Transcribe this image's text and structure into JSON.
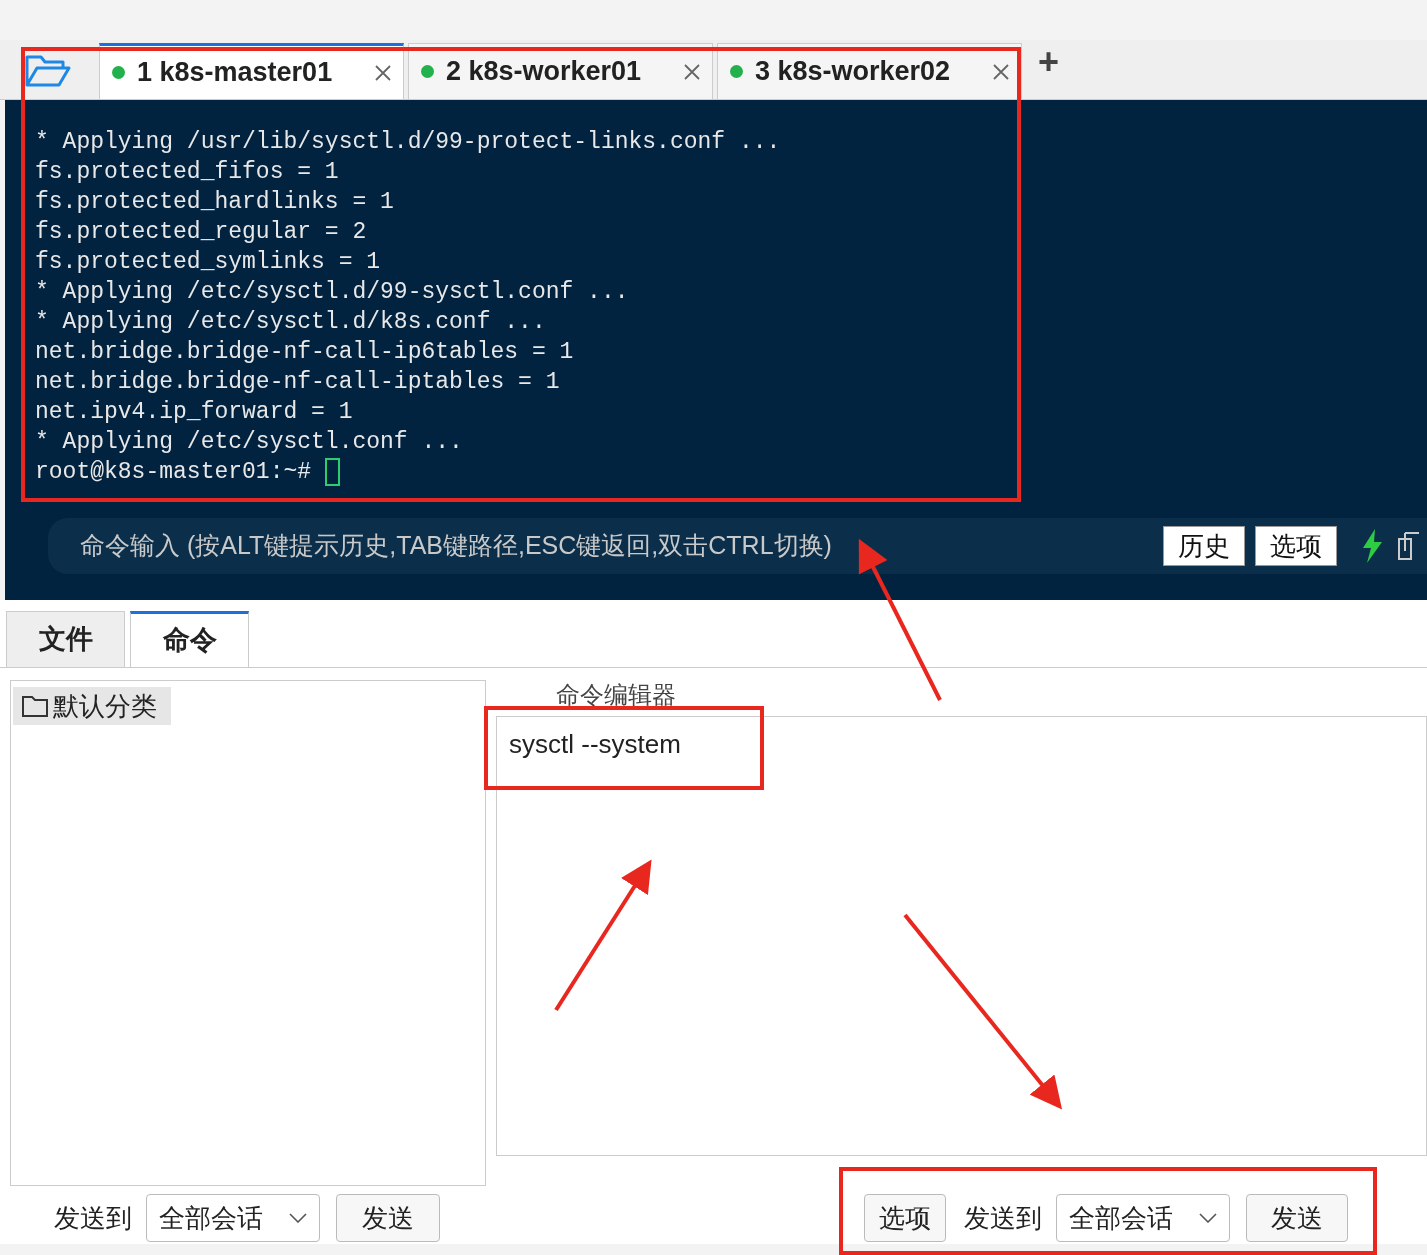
{
  "session_tabs": [
    {
      "label": "1 k8s-master01",
      "color": "#22b14c",
      "selected": true
    },
    {
      "label": "2 k8s-worker01",
      "color": "#22b14c",
      "selected": false
    },
    {
      "label": "3 k8s-worker02",
      "color": "#22b14c",
      "selected": false
    }
  ],
  "new_tab": "+",
  "terminal": {
    "lines": [
      "* Applying /usr/lib/sysctl.d/99-protect-links.conf ...",
      "fs.protected_fifos = 1",
      "fs.protected_hardlinks = 1",
      "fs.protected_regular = 2",
      "fs.protected_symlinks = 1",
      "* Applying /etc/sysctl.d/99-sysctl.conf ...",
      "* Applying /etc/sysctl.d/k8s.conf ...",
      "net.bridge.bridge-nf-call-ip6tables = 1",
      "net.bridge.bridge-nf-call-iptables = 1",
      "net.ipv4.ip_forward = 1",
      "* Applying /etc/sysctl.conf ..."
    ],
    "prompt": "root@k8s-master01:~#"
  },
  "command_input": {
    "placeholder": "命令输入 (按ALT键提示历史,TAB键路径,ESC键返回,双击CTRL切换)",
    "buttons": [
      "历史",
      "选项"
    ]
  },
  "panel_tabs": [
    {
      "label": "文件",
      "selected": false
    },
    {
      "label": "命令",
      "selected": true
    }
  ],
  "category": "默认分类",
  "editor": {
    "title": "命令编辑器",
    "value": "sysctl --system"
  },
  "left_bar": {
    "send_to": "发送到",
    "target": "全部会话",
    "send": "发送"
  },
  "right_bar": {
    "options": "选项",
    "send_to": "发送到",
    "target": "全部会话",
    "send": "发送"
  }
}
